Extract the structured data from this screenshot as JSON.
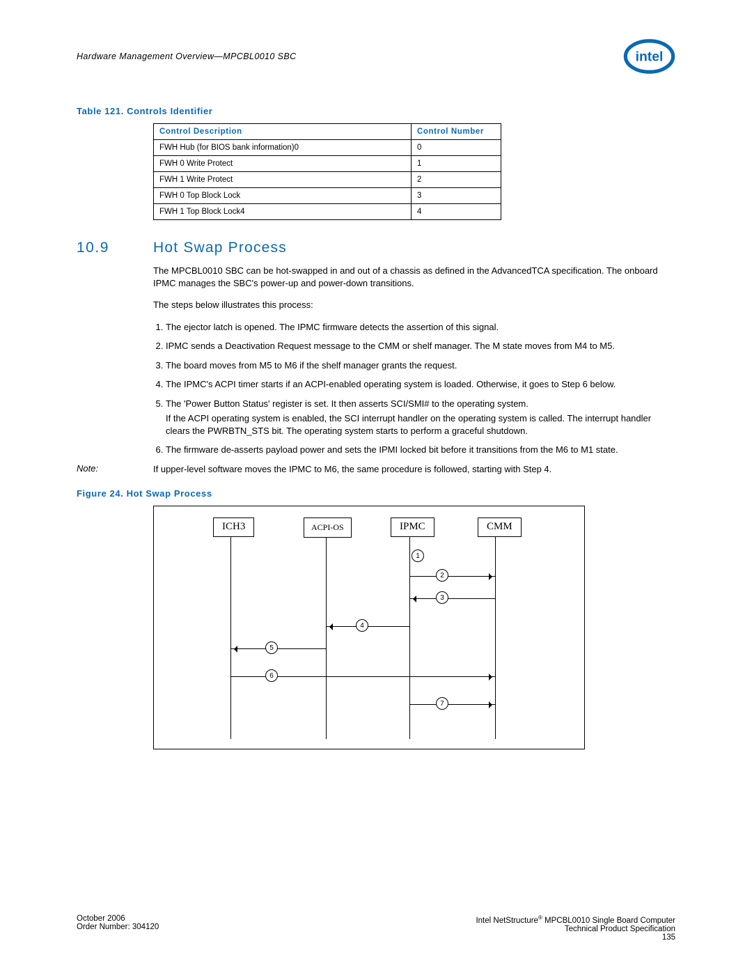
{
  "header": {
    "running_head": "Hardware Management Overview—MPCBL0010 SBC",
    "logo_alt": "intel-logo"
  },
  "table_caption": "Table 121.   Controls Identifier",
  "table": {
    "headers": [
      "Control Description",
      "Control Number"
    ],
    "rows": [
      [
        "FWH Hub (for BIOS bank information)0",
        "0"
      ],
      [
        "FWH 0 Write Protect",
        "1"
      ],
      [
        "FWH 1 Write Protect",
        "2"
      ],
      [
        "FWH 0 Top Block Lock",
        "3"
      ],
      [
        "FWH 1 Top Block Lock4",
        "4"
      ]
    ]
  },
  "section": {
    "number": "10.9",
    "title": "Hot Swap Process",
    "intro": "The MPCBL0010 SBC can be hot-swapped in and out of a chassis as defined in the AdvancedTCA specification. The onboard IPMC manages the SBC's power-up and power-down transitions.",
    "lead": "The steps below illustrates this process:",
    "steps": [
      "The ejector latch is opened. The IPMC firmware detects the assertion of this signal.",
      "IPMC sends a Deactivation Request message to the CMM or shelf manager. The M state moves from M4 to M5.",
      "The board moves from M5 to M6 if the shelf manager grants the request.",
      "The IPMC's ACPI timer starts if an ACPI-enabled operating system is loaded. Otherwise, it goes to Step 6 below.",
      "The 'Power Button Status' register is set. It then asserts SCI/SMI# to the operating system.",
      "The firmware de-asserts payload power and sets the IPMI locked bit before it transitions from the M6 to M1 state."
    ],
    "step5_sub": "If the ACPI operating system is enabled, the SCI interrupt handler on the operating system is called. The interrupt handler clears the PWRBTN_STS bit. The operating system starts to perform a graceful shutdown.",
    "note_label": "Note:",
    "note_text": "If upper-level software moves the IPMC to M6, the same procedure is followed, starting with Step 4."
  },
  "figure_caption": "Figure 24.   Hot Swap Process",
  "figure": {
    "entities": [
      "ICH3",
      "ACPI-OS",
      "IPMC",
      "CMM"
    ],
    "step_labels": [
      "1",
      "2",
      "3",
      "4",
      "5",
      "6",
      "7"
    ]
  },
  "footer": {
    "left_line1": "October 2006",
    "left_line2": "Order Number: 304120",
    "right_line1_a": "Intel NetStructure",
    "right_line1_b": " MPCBL0010 Single Board Computer",
    "right_line2": "Technical Product Specification",
    "right_line3": "135"
  }
}
